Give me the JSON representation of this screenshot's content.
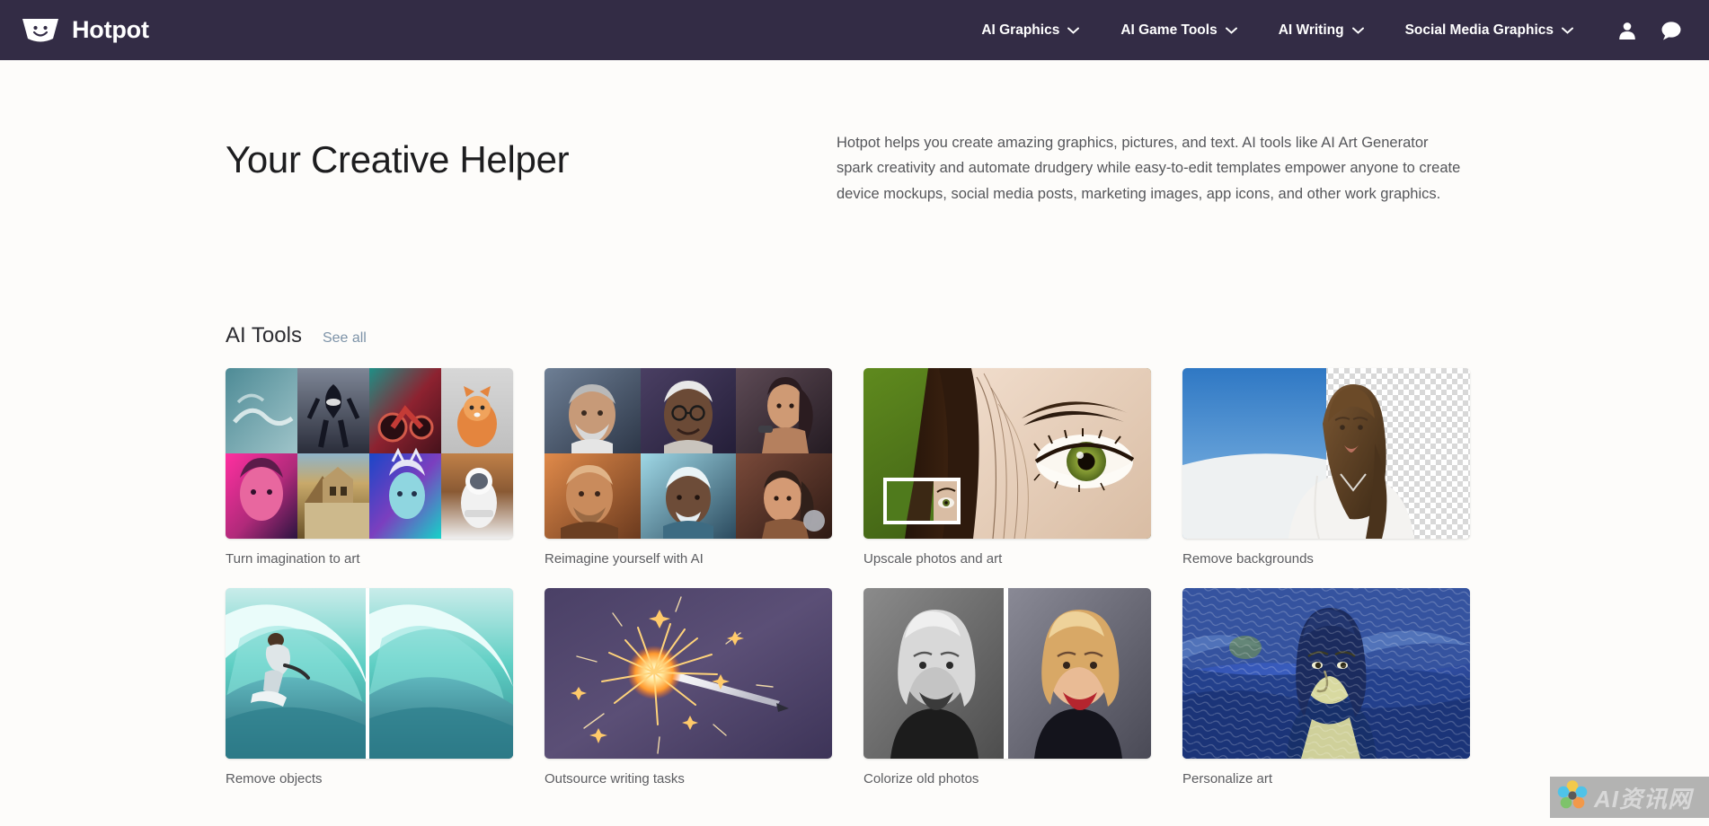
{
  "header": {
    "brand_name": "Hotpot",
    "logo_icon": "hotpot-smiling-pot-icon",
    "nav_items": [
      {
        "label": "AI Graphics",
        "icon": "chevron-down-icon"
      },
      {
        "label": "AI Game Tools",
        "icon": "chevron-down-icon"
      },
      {
        "label": "AI Writing",
        "icon": "chevron-down-icon"
      },
      {
        "label": "Social Media Graphics",
        "icon": "chevron-down-icon"
      }
    ],
    "account_icon": "user-account-icon",
    "chat_icon": "chat-bubble-icon",
    "background_color": "#332c45"
  },
  "hero": {
    "title": "Your Creative Helper",
    "description": "Hotpot helps you create amazing graphics, pictures, and text. AI tools like AI Art Generator spark creativity and automate drudgery while easy-to-edit templates empower anyone to create device mockups, social media posts, marketing images, app icons, and other work graphics."
  },
  "section": {
    "title": "AI Tools",
    "see_all_label": "See all",
    "see_all_color": "#7d93a8"
  },
  "cards": [
    {
      "label": "Turn imagination to art",
      "thumb": "ai-art-collage-grid"
    },
    {
      "label": "Reimagine yourself with AI",
      "thumb": "ai-portrait-collage-grid"
    },
    {
      "label": "Upscale photos and art",
      "thumb": "eye-closeup-upscale"
    },
    {
      "label": "Remove backgrounds",
      "thumb": "portrait-transparent-background"
    },
    {
      "label": "Remove objects",
      "thumb": "surfer-wave-before-after"
    },
    {
      "label": "Outsource writing tasks",
      "thumb": "sparking-pen"
    },
    {
      "label": "Colorize old photos",
      "thumb": "bw-to-color-portrait"
    },
    {
      "label": "Personalize art",
      "thumb": "mona-lisa-van-gogh-style"
    }
  ],
  "watermark": {
    "text": "AI资讯网",
    "icon": "flower-logo-icon"
  }
}
